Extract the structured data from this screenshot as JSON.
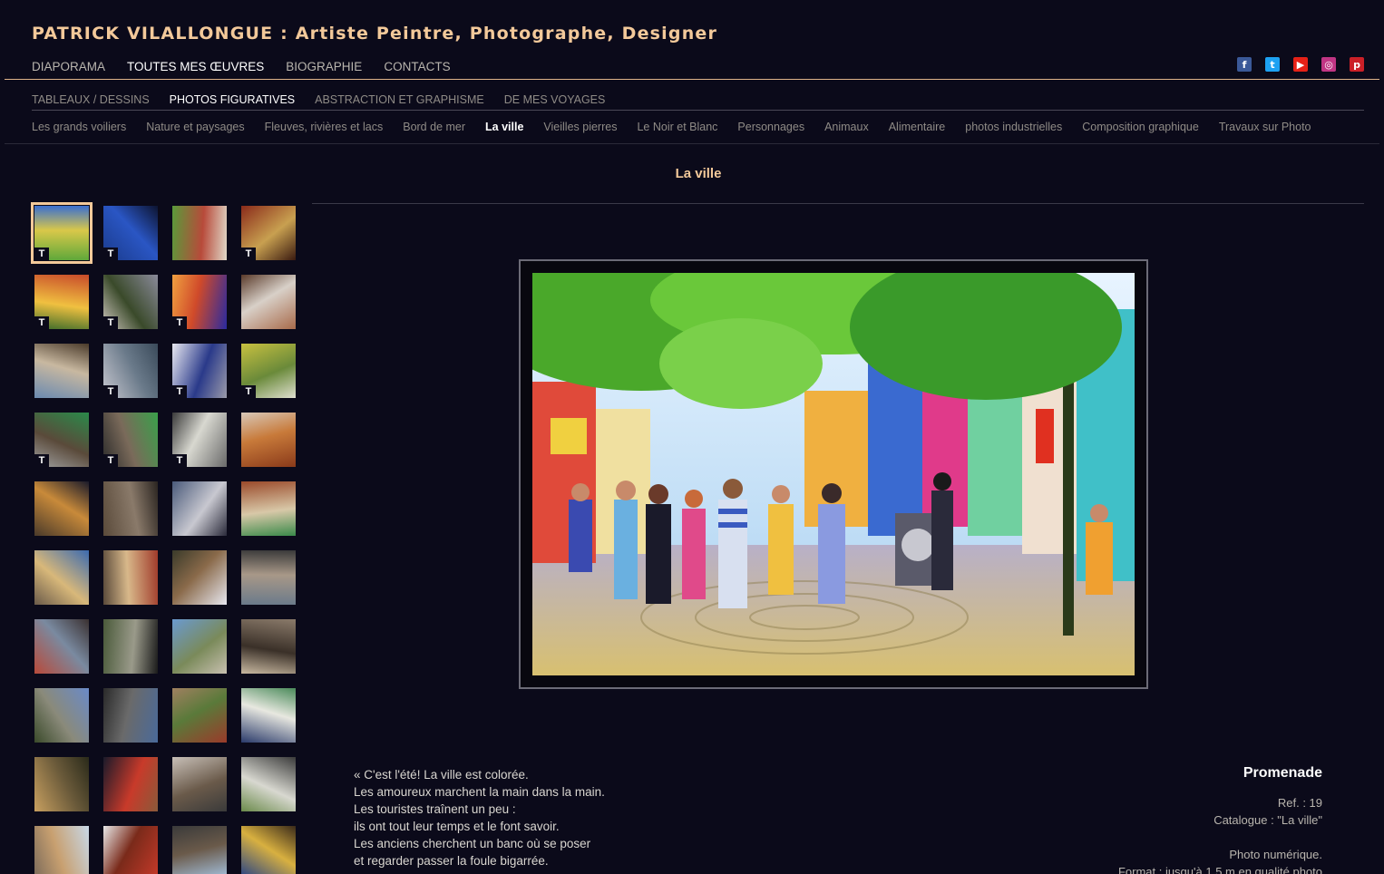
{
  "site": {
    "title": "PATRICK VILALLONGUE : Artiste Peintre, Photographe, Designer"
  },
  "main_nav": [
    {
      "label": "DIAPORAMA",
      "active": false
    },
    {
      "label": "TOUTES MES ŒUVRES",
      "active": true
    },
    {
      "label": "BIOGRAPHIE",
      "active": false
    },
    {
      "label": "CONTACTS",
      "active": false
    }
  ],
  "social": [
    {
      "name": "facebook-icon",
      "glyph": "f",
      "color": "#3b5998"
    },
    {
      "name": "twitter-icon",
      "glyph": "t",
      "color": "#1da1f2"
    },
    {
      "name": "youtube-icon",
      "glyph": "▶",
      "color": "#e62117"
    },
    {
      "name": "instagram-icon",
      "glyph": "◎",
      "color": "#c13584"
    },
    {
      "name": "pinterest-icon",
      "glyph": "p",
      "color": "#cb2027"
    }
  ],
  "sub_nav": [
    {
      "label": "TABLEAUX / DESSINS",
      "active": false
    },
    {
      "label": "PHOTOS FIGURATIVES",
      "active": true
    },
    {
      "label": "ABSTRACTION ET GRAPHISME",
      "active": false
    },
    {
      "label": "DE MES VOYAGES",
      "active": false
    }
  ],
  "categories": [
    {
      "label": "Les grands voiliers",
      "active": false
    },
    {
      "label": "Nature et paysages",
      "active": false
    },
    {
      "label": "Fleuves, rivières et lacs",
      "active": false
    },
    {
      "label": "Bord de mer",
      "active": false
    },
    {
      "label": "La ville",
      "active": true
    },
    {
      "label": "Vieilles pierres",
      "active": false
    },
    {
      "label": "Le Noir et Blanc",
      "active": false
    },
    {
      "label": "Personnages",
      "active": false
    },
    {
      "label": "Animaux",
      "active": false
    },
    {
      "label": "Alimentaire",
      "active": false
    },
    {
      "label": "photos industrielles",
      "active": false
    },
    {
      "label": "Composition graphique",
      "active": false
    },
    {
      "label": "Travaux sur Photo",
      "active": false
    }
  ],
  "page": {
    "heading": "La ville"
  },
  "thumbnails": [
    {
      "badge": "T",
      "selected": true,
      "colors": [
        "#5fa83a",
        "#d9c84a",
        "#3a6fd0"
      ]
    },
    {
      "badge": "T",
      "selected": false,
      "colors": [
        "#1a3a8a",
        "#2a56c4",
        "#0d1430"
      ]
    },
    {
      "badge": "",
      "selected": false,
      "colors": [
        "#5a9a3a",
        "#b84a3a",
        "#e0d8c8"
      ]
    },
    {
      "badge": "T",
      "selected": false,
      "colors": [
        "#8a2a1a",
        "#c8a050",
        "#3a1a10"
      ]
    },
    {
      "badge": "T",
      "selected": false,
      "colors": [
        "#c84a2a",
        "#f0c040",
        "#3a6a2a"
      ]
    },
    {
      "badge": "T",
      "selected": false,
      "colors": [
        "#8a8a9a",
        "#3a4a2a",
        "#d0c8c0"
      ]
    },
    {
      "badge": "T",
      "selected": false,
      "colors": [
        "#2a2aa0",
        "#d04a2a",
        "#f0a040"
      ]
    },
    {
      "badge": "",
      "selected": false,
      "colors": [
        "#a86a4a",
        "#d8d0c8",
        "#5a3a2a"
      ]
    },
    {
      "badge": "",
      "selected": false,
      "colors": [
        "#6a8ab0",
        "#c8b8a0",
        "#4a3a2a"
      ]
    },
    {
      "badge": "T",
      "selected": false,
      "colors": [
        "#c8c8d0",
        "#6a7a8a",
        "#3a4a5a"
      ]
    },
    {
      "badge": "T",
      "selected": false,
      "colors": [
        "#e8e8f0",
        "#2a3a8a",
        "#9a9aaa"
      ]
    },
    {
      "badge": "T",
      "selected": false,
      "colors": [
        "#c8c040",
        "#6a8a3a",
        "#e0e0d0"
      ]
    },
    {
      "badge": "T",
      "selected": false,
      "colors": [
        "#2a8a4a",
        "#5a4a3a",
        "#a0a0a0"
      ]
    },
    {
      "badge": "T",
      "selected": false,
      "colors": [
        "#3aa04a",
        "#7a6a5a",
        "#2a2a2a"
      ]
    },
    {
      "badge": "T",
      "selected": false,
      "colors": [
        "#6a6a6a",
        "#d8d8d0",
        "#3a3a3a"
      ]
    },
    {
      "badge": "",
      "selected": false,
      "colors": [
        "#8a3a1a",
        "#c87a3a",
        "#d8c8b8"
      ]
    },
    {
      "badge": "",
      "selected": false,
      "colors": [
        "#4a3a2a",
        "#c88a3a",
        "#1a1a2a"
      ]
    },
    {
      "badge": "",
      "selected": false,
      "colors": [
        "#5a4a3a",
        "#8a7a6a",
        "#2a2420"
      ]
    },
    {
      "badge": "",
      "selected": false,
      "colors": [
        "#4a5a7a",
        "#c8c8d0",
        "#2a2a3a"
      ]
    },
    {
      "badge": "",
      "selected": false,
      "colors": [
        "#9a4a2a",
        "#d8c8a8",
        "#3a8a4a"
      ]
    },
    {
      "badge": "",
      "selected": false,
      "colors": [
        "#3a6ab0",
        "#d8b87a",
        "#6a5a4a"
      ]
    },
    {
      "badge": "",
      "selected": false,
      "colors": [
        "#a03a2a",
        "#d8b88a",
        "#5a4a3a"
      ]
    },
    {
      "badge": "",
      "selected": false,
      "colors": [
        "#e8e8f0",
        "#8a6a4a",
        "#3a3a2a"
      ]
    },
    {
      "badge": "",
      "selected": false,
      "colors": [
        "#6a7a8a",
        "#a89888",
        "#3a3a3a"
      ]
    },
    {
      "badge": "",
      "selected": false,
      "colors": [
        "#b84a3a",
        "#7a8aa0",
        "#3a3030"
      ]
    },
    {
      "badge": "",
      "selected": false,
      "colors": [
        "#4a5a3a",
        "#9a9a8a",
        "#1a1a1a"
      ]
    },
    {
      "badge": "",
      "selected": false,
      "colors": [
        "#6a9ad0",
        "#7a8a5a",
        "#c8c0b0"
      ]
    },
    {
      "badge": "",
      "selected": false,
      "colors": [
        "#8a7a6a",
        "#3a3028",
        "#c8b8a0"
      ]
    },
    {
      "badge": "",
      "selected": false,
      "colors": [
        "#6a8ac8",
        "#8a8a7a",
        "#3a4a2a"
      ]
    },
    {
      "badge": "",
      "selected": false,
      "colors": [
        "#4a6a9a",
        "#6a6a6a",
        "#2a2a2a"
      ]
    },
    {
      "badge": "",
      "selected": false,
      "colors": [
        "#9a3a2a",
        "#5a7a3a",
        "#a08060"
      ]
    },
    {
      "badge": "",
      "selected": false,
      "colors": [
        "#2a3a6a",
        "#e8e8e0",
        "#4a8a5a"
      ]
    },
    {
      "badge": "",
      "selected": false,
      "colors": [
        "#c8a060",
        "#6a5a3a",
        "#2a2a1a"
      ]
    },
    {
      "badge": "",
      "selected": false,
      "colors": [
        "#1a1a2a",
        "#c83a2a",
        "#8a5a3a"
      ]
    },
    {
      "badge": "",
      "selected": false,
      "colors": [
        "#c8c0b8",
        "#6a5a4a",
        "#3a3a3a"
      ]
    },
    {
      "badge": "",
      "selected": false,
      "colors": [
        "#3a3a3a",
        "#d8d8d0",
        "#6a8a4a"
      ]
    },
    {
      "badge": "",
      "selected": false,
      "colors": [
        "#c8d8e8",
        "#c8a070",
        "#7a6a5a"
      ]
    },
    {
      "badge": "",
      "selected": false,
      "colors": [
        "#c83a2a",
        "#7a2a1a",
        "#e8e8e8"
      ]
    },
    {
      "badge": "",
      "selected": false,
      "colors": [
        "#a8c8e8",
        "#6a5a4a",
        "#3a3a3a"
      ]
    },
    {
      "badge": "",
      "selected": false,
      "colors": [
        "#1a3a8a",
        "#d8b040",
        "#3a2a1a"
      ]
    }
  ],
  "artwork": {
    "title": "Promenade",
    "ref": "Ref. : 19",
    "catalogue": "Catalogue : \"La ville\"",
    "medium": "Photo numérique.",
    "format_partial": "Format : jusqu'à 1,5 m en qualité photo",
    "quote_lines": [
      "« C'est l'été! La ville est colorée.",
      "Les amoureux marchent la main dans la main.",
      "Les touristes traînent un peu :",
      "ils ont tout leur temps et le font savoir.",
      "Les anciens cherchent un banc où se poser",
      "et regarder passer la foule bigarrée."
    ]
  }
}
